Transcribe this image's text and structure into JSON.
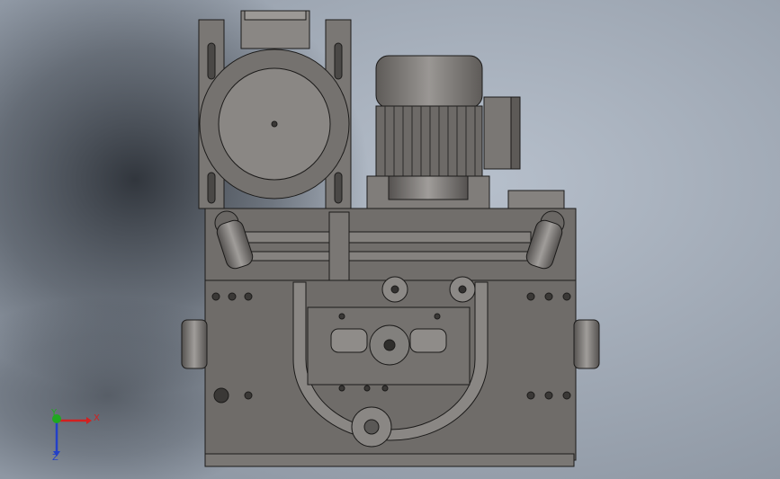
{
  "viewport": {
    "background_center": "#b6bfcb",
    "background_edge": "#8e97a3",
    "shadow_color": "#1e2228"
  },
  "model": {
    "body_color": "#6f6c69",
    "plate_color": "#7a7774",
    "motor_color": "#858280",
    "line_color": "#1c1b1a",
    "highlight_color": "#a19e9b"
  },
  "triad": {
    "x_label": "X",
    "y_label": "Y",
    "z_label": "Z",
    "x_color": "#d32020",
    "y_color": "#1fa81f",
    "z_color": "#2340c8"
  }
}
